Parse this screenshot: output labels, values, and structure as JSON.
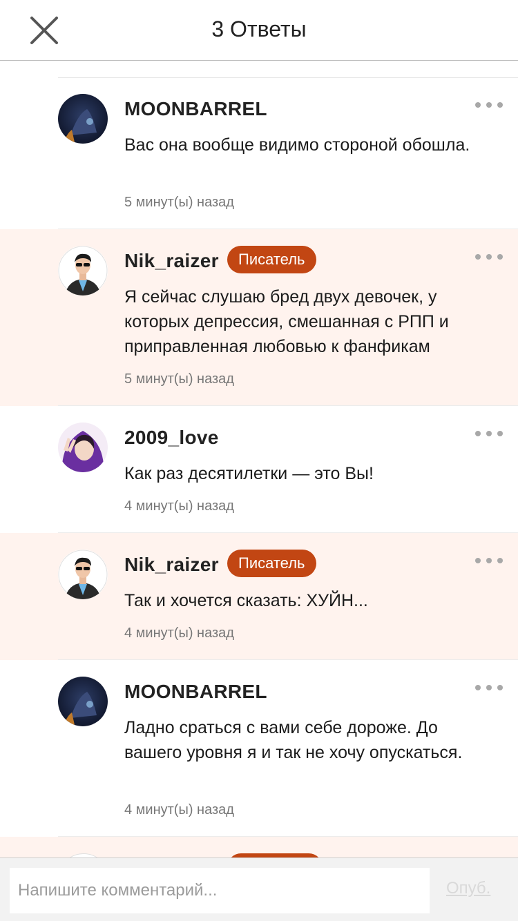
{
  "header": {
    "title": "3 Ответы",
    "close_icon": "close-icon"
  },
  "colors": {
    "writer_bg": "#fff3ee",
    "badge": "#c24613"
  },
  "replies": [
    {
      "username": "MOONBARREL",
      "badge": "",
      "text": "Вас она вообще видимо стороной обошла.",
      "time": "5 минут(ы) назад",
      "avatar": "moon-avatar"
    },
    {
      "username": "Nik_raizer",
      "badge": "Писатель",
      "text": "Я сейчас слушаю бред двух девочек, у которых депрессия, смешанная с РПП и приправленная любовью к фанфикам",
      "time": "5 минут(ы) назад",
      "avatar": "man-sunglasses-avatar"
    },
    {
      "username": "2009_love",
      "badge": "",
      "text": "Как раз десятилетки — это Вы!",
      "time": "4 минут(ы) назад",
      "avatar": "purple-hood-avatar"
    },
    {
      "username": "Nik_raizer",
      "badge": "Писатель",
      "text": "Так и хочется сказать: ХУЙН...",
      "time": "4 минут(ы) назад",
      "avatar": "man-sunglasses-avatar"
    },
    {
      "username": "MOONBARREL",
      "badge": "",
      "text": "Ладно сраться с вами себе дороже. До вашего уровня я и так не хочу опускаться.",
      "time": "4 минут(ы) назад",
      "avatar": "moon-avatar"
    }
  ],
  "footer": {
    "placeholder": "Напишите комментарий...",
    "publish_label": "Опуб."
  }
}
